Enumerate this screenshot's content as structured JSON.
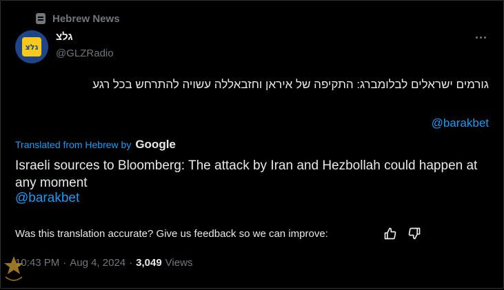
{
  "context": {
    "label": "Hebrew News",
    "icon": "community-tag-icon"
  },
  "author": {
    "name": "גלצ",
    "handle": "@GLZRadio",
    "avatar_text": "גלצ"
  },
  "tweet": {
    "text_he": "גורמים ישראלים לבלומברג: התקיפה של איראן וחזבאללה עשויה להתרחש בכל רגע",
    "mention_he": "@barakbet"
  },
  "translation": {
    "label": "Translated from Hebrew by",
    "provider": "Google",
    "text_en": "Israeli sources to Bloomberg: The attack by Iran and Hezbollah could happen at any moment",
    "mention_en": "@barakbet"
  },
  "feedback": {
    "question": "Was this translation accurate? Give us feedback so we can improve:"
  },
  "meta": {
    "time": "10:43 PM",
    "sep1": "·",
    "date": "Aug 4, 2024",
    "sep2": "·",
    "views_count": "3,049",
    "views_label": "Views"
  },
  "colors": {
    "accent": "#1d9bf0",
    "muted": "#71767b",
    "text": "#e7e9ea",
    "background": "#000000"
  }
}
